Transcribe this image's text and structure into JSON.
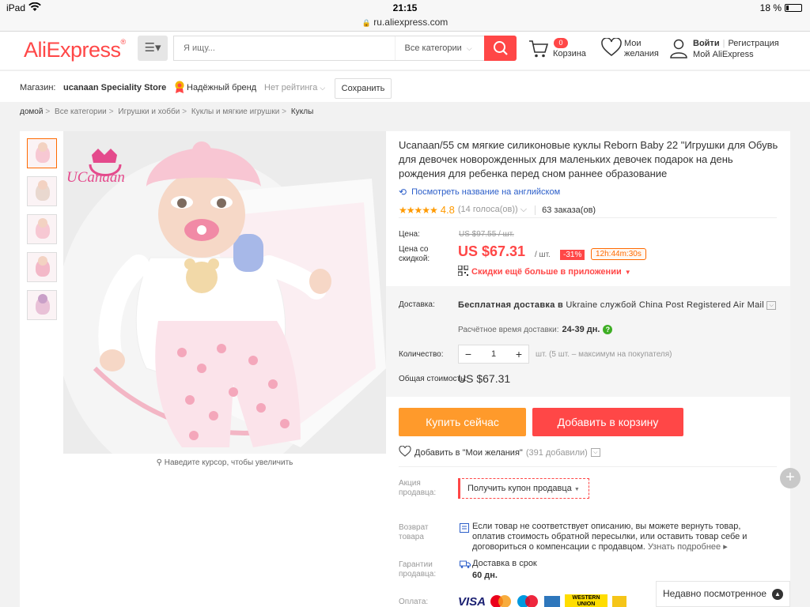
{
  "statusbar": {
    "device": "iPad",
    "time": "21:15",
    "battery": "18 %",
    "url": "ru.aliexpress.com",
    "battery_level": 0.18
  },
  "header": {
    "logo": "AliExpress",
    "search_placeholder": "Я ищу...",
    "category": "Все категории",
    "cart_count": "0",
    "cart_label": "Корзина",
    "wish_label": "Мои желания",
    "login": "Войти",
    "register": "Регистрация",
    "my_account": "Мой AliExpress",
    "brand_color": "#ff4747"
  },
  "store": {
    "label": "Магазин:",
    "name": "ucanaan Speciality Store",
    "brand_badge": "Надёжный бренд",
    "rating": "Нет рейтинга",
    "save_label": "Сохранить"
  },
  "breadcrumb": [
    "домой",
    "Все категории",
    "Игрушки и хобби",
    "Куклы и мягкие игрушки",
    "Куклы"
  ],
  "gallery": {
    "brand_text": "UCanaan",
    "zoom_hint": "Наведите курсор, чтобы увеличить"
  },
  "product": {
    "title": "Ucanaan/55 см мягкие силиконовые куклы Reborn Baby 22 \"Игрушки для Обувь для девочек новорожденных для маленьких девочек подарок на день рождения для ребенка перед сном раннее образование",
    "translate_link": "Посмотреть название на английском",
    "stars": "★★★★★",
    "score": "4.8",
    "votes": "(14 голоса(ов))",
    "orders": "63 заказа(ов)",
    "price_label": "Цена:",
    "old_price": "US $97.55 / шт.",
    "discount_label": "Цена со скидкой:",
    "price": "US $67.31",
    "unit": "/ шт.",
    "discount_pct": "-31%",
    "timer": "12h:44m:30s",
    "app_deal": "Скидки ещё больше в приложении"
  },
  "shipping": {
    "label": "Доставка:",
    "text_bold": "Бесплатная доставка в",
    "text_rest": "Ukraine службой China Post Registered Air Mail",
    "eta_label": "Расчётное время доставки:",
    "eta_value": "24-39 дн.",
    "qty_label": "Количество:",
    "qty_minus": "−",
    "qty_value": "1",
    "qty_plus": "+",
    "qty_note": "шт. (5 шт. – максимум на покупателя)",
    "total_label": "Общая стоимость:",
    "total_value": "US $67.31"
  },
  "actions": {
    "buy_now": "Купить сейчас",
    "add_to_cart": "Добавить в корзину",
    "wish_add": "Добавить в \"Мои желания\"",
    "wish_count": "(391 добавили)"
  },
  "details": {
    "promo_label": "Акция продавца:",
    "coupon": "Получить купон продавца",
    "return_label": "Возврат товара",
    "return_text": "Если товар не соответствует описанию, вы можете вернуть товар, оплатив стоимость обратной пересылки, или оставить товар себе и договориться о компенсации с продавцом.",
    "return_more": "Узнать подробнее",
    "guarantee_label": "Гарантии продавца:",
    "guarantee_text": "Доставка в срок",
    "guarantee_days": "60 дн.",
    "payment_label": "Оплата:",
    "payments": [
      "VISA",
      "WESTERN UNION"
    ]
  },
  "recent": {
    "label": "Недавно посмотренное"
  }
}
